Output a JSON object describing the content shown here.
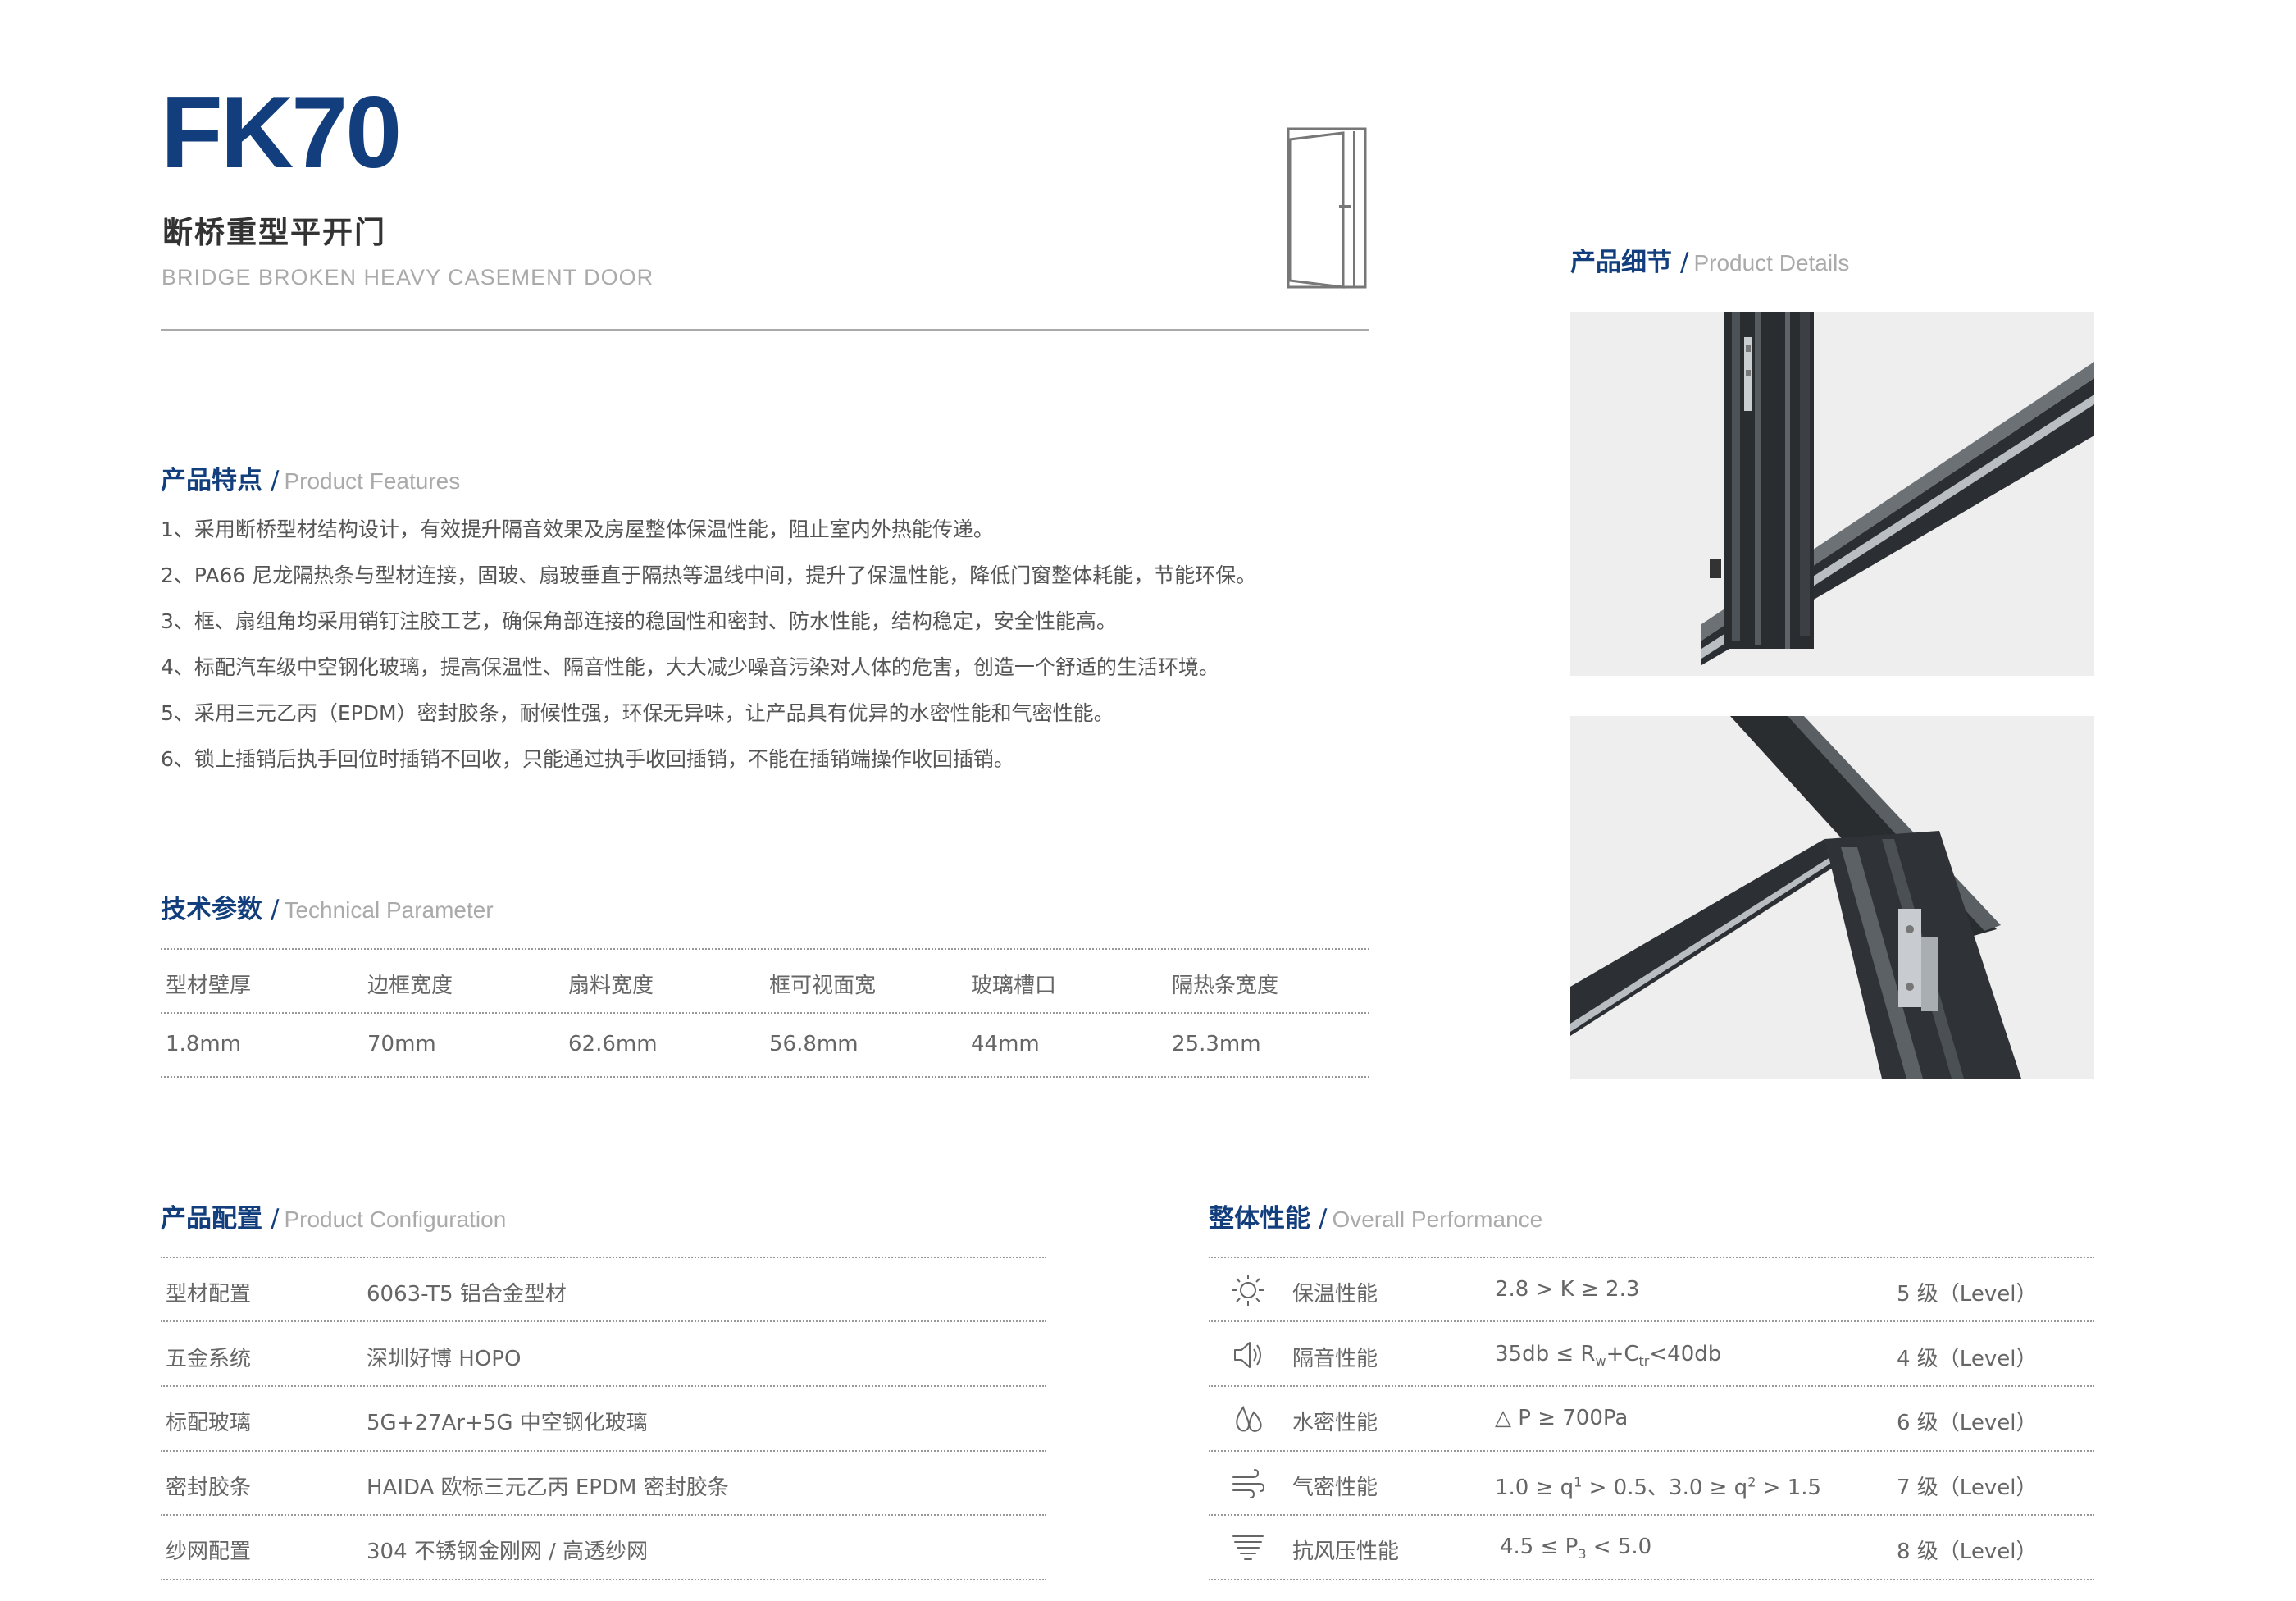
{
  "header": {
    "model": "FK70",
    "name_cn": "断桥重型平开门",
    "name_en": "BRIDGE BROKEN HEAVY CASEMENT DOOR"
  },
  "features": {
    "title_cn": "产品特点",
    "title_en": "Product Features",
    "items": [
      "1、采用断桥型材结构设计，有效提升隔音效果及房屋整体保温性能，阻止室内外热能传递。",
      "2、PA66 尼龙隔热条与型材连接，固玻、扇玻垂直于隔热等温线中间，提升了保温性能，降低门窗整体耗能，节能环保。",
      "3、框、扇组角均采用销钉注胶工艺，确保角部连接的稳固性和密封、防水性能，结构稳定，安全性能高。",
      "4、标配汽车级中空钢化玻璃，提高保温性、隔音性能，大大减少噪音污染对人体的危害，创造一个舒适的生活环境。",
      "5、采用三元乙丙（EPDM）密封胶条，耐候性强，环保无异味，让产品具有优异的水密性能和气密性能。",
      "6、锁上插销后执手回位时插销不回收，只能通过执手收回插销，不能在插销端操作收回插销。"
    ]
  },
  "tech": {
    "title_cn": "技术参数",
    "title_en": "Technical Parameter",
    "headers": [
      "型材壁厚",
      "边框宽度",
      "扇料宽度",
      "框可视面宽",
      "玻璃槽口",
      "隔热条宽度"
    ],
    "values": [
      "1.8mm",
      "70mm",
      "62.6mm",
      "56.8mm",
      "44mm",
      "25.3mm"
    ]
  },
  "details": {
    "title_cn": "产品细节",
    "title_en": "Product Details"
  },
  "config": {
    "title_cn": "产品配置",
    "title_en": "Product Configuration",
    "rows": [
      {
        "label": "型材配置",
        "value": "6063-T5 铝合金型材"
      },
      {
        "label": "五金系统",
        "value": "深圳好博 HOPO"
      },
      {
        "label": "标配玻璃",
        "value": "5G+27Ar+5G 中空钢化玻璃"
      },
      {
        "label": "密封胶条",
        "value": "HAIDA 欧标三元乙丙 EPDM 密封胶条"
      },
      {
        "label": "纱网配置",
        "value": "304 不锈钢金刚网 / 高透纱网"
      }
    ]
  },
  "performance": {
    "title_cn": "整体性能",
    "title_en": "Overall Performance",
    "rows": [
      {
        "icon": "sun-icon",
        "label": "保温性能",
        "v1": "2.8 > K ≥ 2.3",
        "level": "5 级（Level）"
      },
      {
        "icon": "speaker-icon",
        "label": "隔音性能",
        "v_a": "35db ≤ R",
        "sub1": "w",
        "v_b": "+C",
        "sub2": "tr",
        "v_c": "<40db",
        "level": "4 级（Level）"
      },
      {
        "icon": "water-drops-icon",
        "label": "水密性能",
        "v1": "△ P ≥ 700Pa",
        "level": "6 级（Level）"
      },
      {
        "icon": "wind-icon",
        "label": "气密性能",
        "v_a": "1.0 ≥ q",
        "sup1": "1",
        "v_b": " > 0.5、3.0 ≥ q",
        "sup2": "2",
        "v_c": " > 1.5",
        "level": "7 级（Level）"
      },
      {
        "icon": "wind-pressure-icon",
        "label": "抗风压性能",
        "v_a": "4.5 ≤ P",
        "sub1": "3",
        "v_b": " < 5.0",
        "level": "8 级（Level）"
      }
    ]
  }
}
